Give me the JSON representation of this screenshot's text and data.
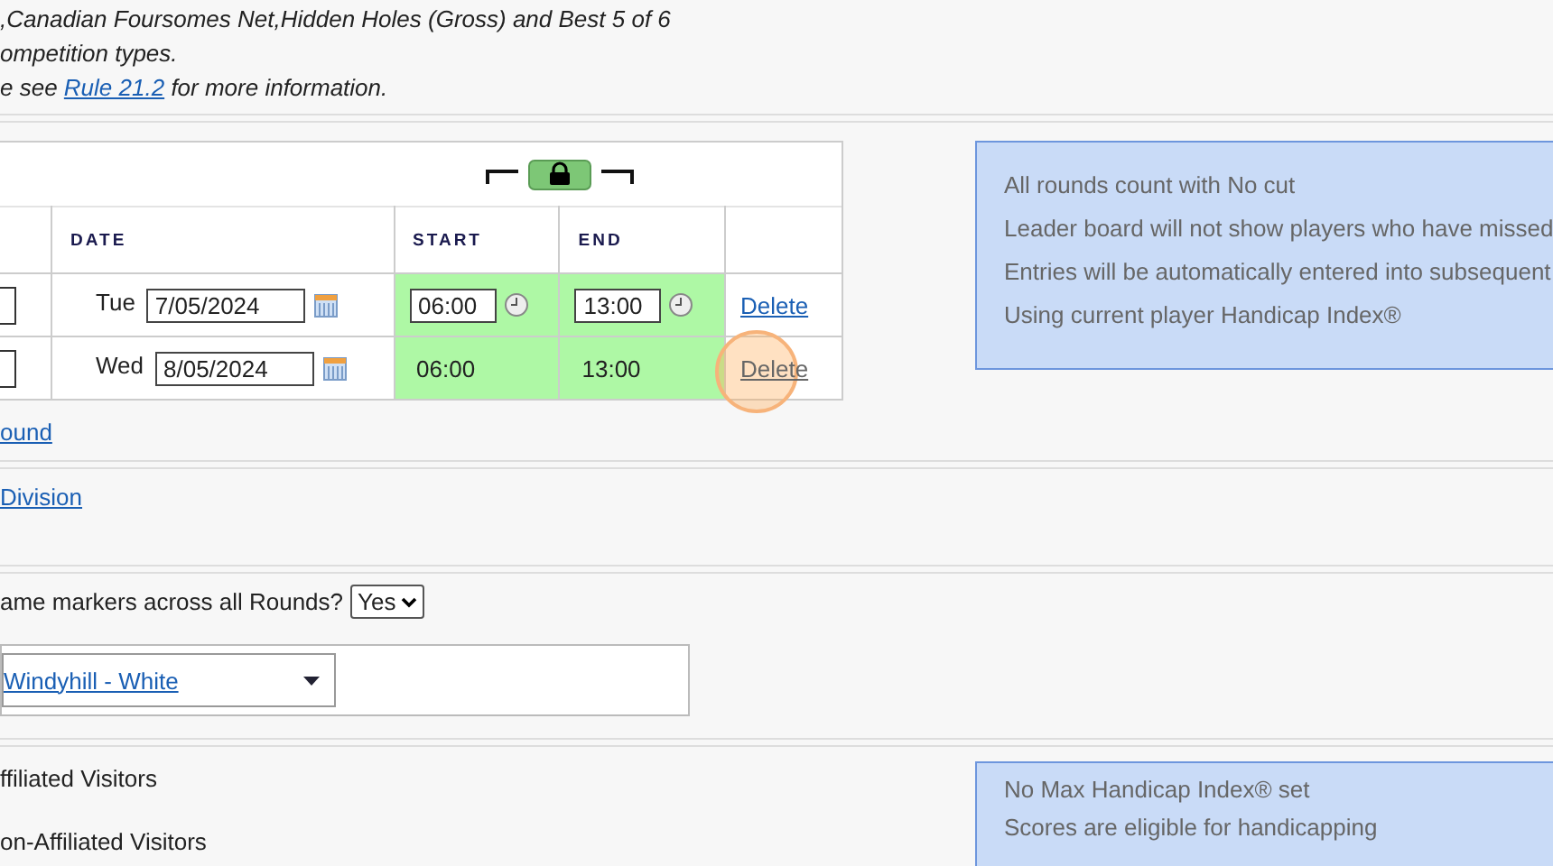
{
  "intro": {
    "lines": [
      ",Canadian Foursomes Net,Hidden Holes (Gross) and Best 5 of 6",
      "ompetition types."
    ],
    "note": {
      "before": "e see ",
      "link": "Rule 21.2",
      "after": " for more information."
    }
  },
  "rounds_table": {
    "columns": [
      "DATE",
      "START",
      "END"
    ],
    "rows": [
      {
        "day": "Tue",
        "date": "7/05/2024",
        "kind": "input",
        "start": "06:00",
        "end": "13:00",
        "action": "Delete",
        "highlighted": false
      },
      {
        "day": "Wed",
        "date": "8/05/2024",
        "kind": "text",
        "start": "06:00",
        "end": "13:00",
        "action": "Delete",
        "highlighted": true
      }
    ]
  },
  "add_round_link": "ound",
  "rounds_info": [
    "All rounds count with No cut",
    "Leader board will not show players who have missed",
    "Entries will be automatically entered into subsequent",
    "Using current player Handicap Index®"
  ],
  "division_link": "Division",
  "markers": {
    "question": "ame markers across all Rounds?",
    "answer": "Yes",
    "tee": "Windyhill - White"
  },
  "visitors": [
    "ffiliated Visitors",
    "on-Affiliated Visitors"
  ],
  "handicap_info": [
    "No Max Handicap Index® set",
    "Scores are eligible for handicapping"
  ]
}
